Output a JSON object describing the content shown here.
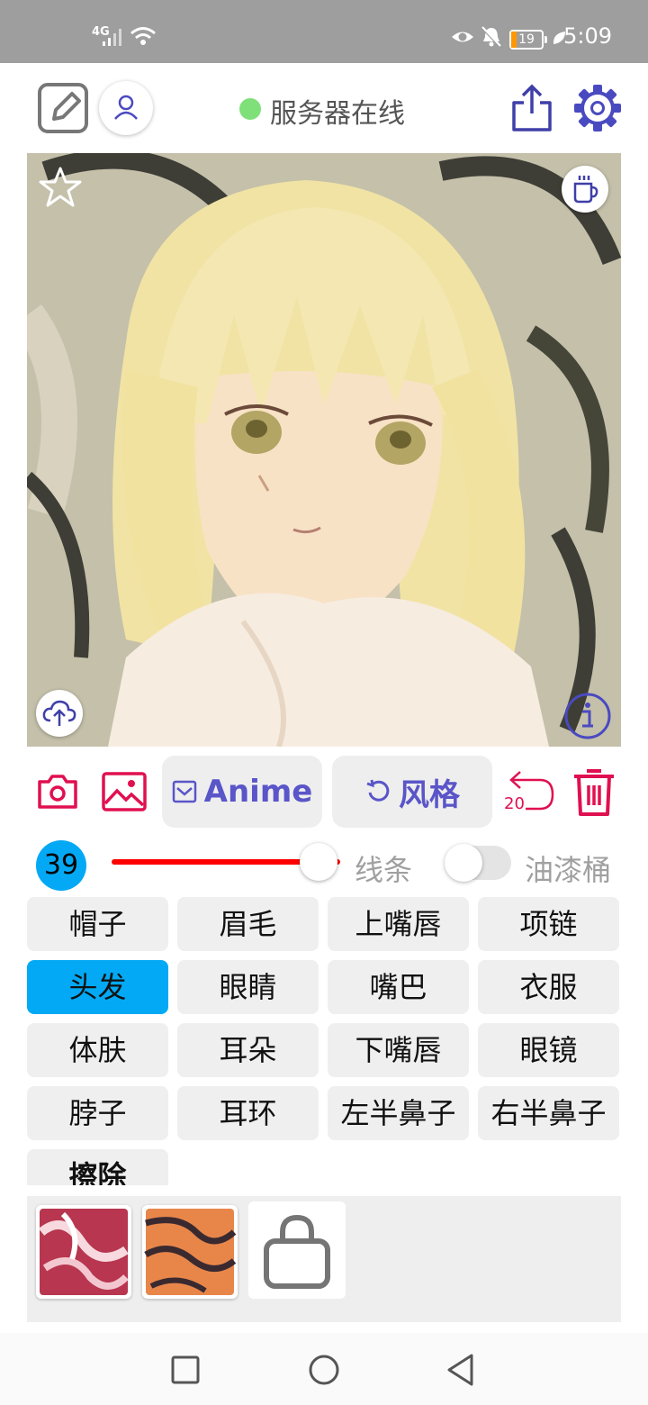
{
  "status_bar": {
    "network": "4G",
    "battery": "19",
    "time": "5:09"
  },
  "toolbar": {
    "server_status": "服务器在线",
    "server_status_color": "#7fe07a",
    "icons": [
      "edit-icon",
      "user-icon",
      "share-icon",
      "gear-icon"
    ]
  },
  "canvas": {
    "icons": [
      "star-icon",
      "coffee-cup-icon",
      "cloud-upload-icon",
      "info-icon"
    ]
  },
  "tools": {
    "anime_label": "Anime",
    "style_label": "风格",
    "undo_count": "20",
    "accent_color": "#e01050",
    "pill_text_color": "#5a55c8"
  },
  "brush": {
    "size": "39",
    "slider_fraction": 0.88,
    "slider_color": "#ff0000",
    "line_label": "线条",
    "bucket_label": "油漆桶",
    "bucket_enabled": false
  },
  "parts": [
    {
      "label": "帽子",
      "active": false
    },
    {
      "label": "眉毛",
      "active": false
    },
    {
      "label": "上嘴唇",
      "active": false
    },
    {
      "label": "项链",
      "active": false
    },
    {
      "label": "头发",
      "active": true
    },
    {
      "label": "眼睛",
      "active": false
    },
    {
      "label": "嘴巴",
      "active": false
    },
    {
      "label": "衣服",
      "active": false
    },
    {
      "label": "体肤",
      "active": false
    },
    {
      "label": "耳朵",
      "active": false
    },
    {
      "label": "下嘴唇",
      "active": false
    },
    {
      "label": "眼镜",
      "active": false
    },
    {
      "label": "脖子",
      "active": false
    },
    {
      "label": "耳环",
      "active": false
    },
    {
      "label": "左半鼻子",
      "active": false
    },
    {
      "label": "右半鼻子",
      "active": false
    },
    {
      "label": "擦除",
      "active": false
    }
  ],
  "active_chip_color": "#03a9f4"
}
